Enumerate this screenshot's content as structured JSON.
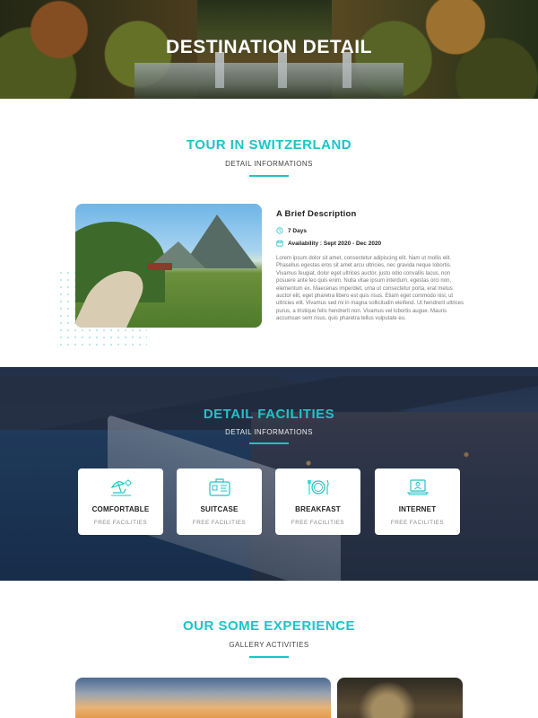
{
  "hero": {
    "title": "DESTINATION DETAIL"
  },
  "tour": {
    "title": "TOUR IN SWITZERLAND",
    "subtitle": "DETAIL INFORMATIONS",
    "heading": "A Brief Description",
    "duration": "7 Days",
    "availability": "Availability : Sept 2020 - Dec 2020",
    "description": "Lorem ipsum dolor sit amet, consectetur adipiscing elit. Nam ut mollis elit. Phasellus egestas eros sit amet arcu ultricies, nec gravida neque lobortis. Vivamus feugiat, dolor eget ultrices auctor, justo odio convallis lacus, non posuere ante leo quis enim. Nulla vitae ipsum interdum, egestas orci non, elementum ex. Maecenas imperdiet, urna ut consectetur porta, erat metus auctor elit, eget pharetra libero est quis risus. Etiam eget commodo nisl, ut ultricies elit. Vivamus sed mi in magna sollicitudin eleifend. Ut hendrerit ultrices purus, a tristique felis hendrerit non. Vivamus vel lobortis augue. Mauris accumsan sem risus, quis pharetra tellus vulputate eu."
  },
  "facilities": {
    "title": "DETAIL FACILITIES",
    "subtitle": "DETAIL INFORMATIONS",
    "cards": [
      {
        "name": "COMFORTABLE",
        "sub": "FREE FACILITIES",
        "icon": "beach-umbrella-icon"
      },
      {
        "name": "SUITCASE",
        "sub": "FREE FACILITIES",
        "icon": "suitcase-icon"
      },
      {
        "name": "BREAKFAST",
        "sub": "FREE FACILITIES",
        "icon": "plate-cutlery-icon"
      },
      {
        "name": "INTERNET",
        "sub": "FREE FACILITIES",
        "icon": "laptop-user-icon"
      }
    ]
  },
  "experience": {
    "title": "OUR SOME EXPERIENCE",
    "subtitle": "GALLERY ACTIVITIES"
  },
  "colors": {
    "accent": "#1ec3c7",
    "text": "#222222",
    "muted": "#777777"
  }
}
